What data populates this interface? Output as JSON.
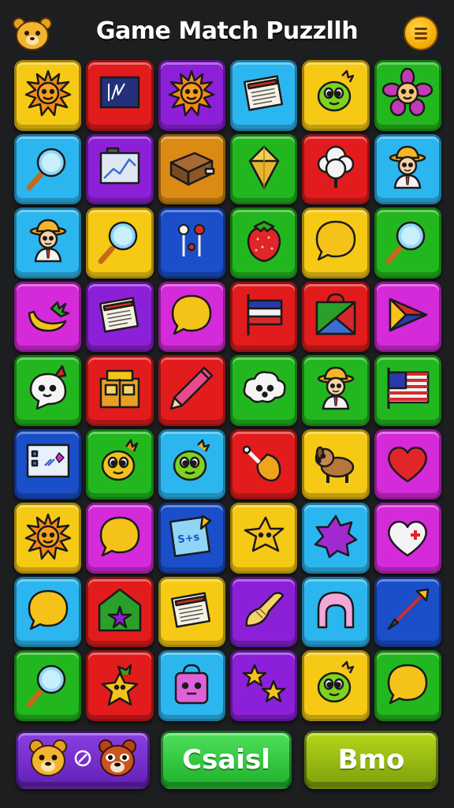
{
  "header": {
    "title": "Game Match Puzzllh",
    "logo_icon": "bear-face-icon",
    "menu_icon": "hamburger-menu-icon"
  },
  "colors": {
    "yellow": "#f6c915",
    "red": "#e21c1c",
    "purple": "#8c20d8",
    "cyan": "#2cb6ef",
    "green": "#22b71e",
    "orange": "#db8a14",
    "blue": "#1a4fc9",
    "magenta": "#d42ad9",
    "background": "#1d1e20"
  },
  "board": {
    "rows": [
      [
        {
          "color": "yellow",
          "icon": "sun-icon"
        },
        {
          "color": "red",
          "icon": "chalkboard-icon"
        },
        {
          "color": "purple",
          "icon": "sun-icon"
        },
        {
          "color": "cyan",
          "icon": "newspaper-icon"
        },
        {
          "color": "yellow",
          "icon": "green-bird-icon"
        },
        {
          "color": "green",
          "icon": "purple-flower-icon"
        }
      ],
      [
        {
          "color": "cyan",
          "icon": "magnifier-icon"
        },
        {
          "color": "purple",
          "icon": "chart-folder-icon"
        },
        {
          "color": "orange",
          "icon": "treasure-box-icon"
        },
        {
          "color": "green",
          "icon": "diamond-icon"
        },
        {
          "color": "red",
          "icon": "cloud-tree-icon"
        },
        {
          "color": "cyan",
          "icon": "explorer-icon"
        }
      ],
      [
        {
          "color": "cyan",
          "icon": "explorer-icon"
        },
        {
          "color": "yellow",
          "icon": "magnifier-icon"
        },
        {
          "color": "blue",
          "icon": "pins-icon"
        },
        {
          "color": "green",
          "icon": "strawberry-icon"
        },
        {
          "color": "yellow",
          "icon": "speech-bubble-icon"
        },
        {
          "color": "green",
          "icon": "magnifier-icon"
        }
      ],
      [
        {
          "color": "magenta",
          "icon": "banana-icon"
        },
        {
          "color": "purple",
          "icon": "newspaper-icon"
        },
        {
          "color": "magenta",
          "icon": "speech-bubble-icon"
        },
        {
          "color": "red",
          "icon": "flag-icon"
        },
        {
          "color": "red",
          "icon": "gift-bag-icon"
        },
        {
          "color": "magenta",
          "icon": "play-flag-icon"
        }
      ],
      [
        {
          "color": "green",
          "icon": "ghost-icon"
        },
        {
          "color": "red",
          "icon": "package-icon"
        },
        {
          "color": "red",
          "icon": "pen-icon"
        },
        {
          "color": "green",
          "icon": "cloud-face-icon"
        },
        {
          "color": "green",
          "icon": "explorer-icon"
        },
        {
          "color": "green",
          "icon": "usa-flag-icon"
        }
      ],
      [
        {
          "color": "blue",
          "icon": "whiteboard-icon"
        },
        {
          "color": "green",
          "icon": "yellow-bird-icon"
        },
        {
          "color": "cyan",
          "icon": "green-bird-icon"
        },
        {
          "color": "red",
          "icon": "chicken-leg-icon"
        },
        {
          "color": "yellow",
          "icon": "dog-icon"
        },
        {
          "color": "magenta",
          "icon": "heart-icon"
        }
      ],
      [
        {
          "color": "yellow",
          "icon": "sun-icon"
        },
        {
          "color": "magenta",
          "icon": "speech-bubble-icon"
        },
        {
          "color": "blue",
          "icon": "notepad-icon"
        },
        {
          "color": "yellow",
          "icon": "star-blob-icon"
        },
        {
          "color": "cyan",
          "icon": "purple-star-icon"
        },
        {
          "color": "magenta",
          "icon": "heart-plus-icon"
        }
      ],
      [
        {
          "color": "cyan",
          "icon": "speech-bubble-icon"
        },
        {
          "color": "red",
          "icon": "house-star-icon"
        },
        {
          "color": "yellow",
          "icon": "newspaper-icon"
        },
        {
          "color": "purple",
          "icon": "brush-icon"
        },
        {
          "color": "cyan",
          "icon": "arch-icon"
        },
        {
          "color": "blue",
          "icon": "arrow-icon"
        }
      ],
      [
        {
          "color": "green",
          "icon": "magnifier-icon"
        },
        {
          "color": "red",
          "icon": "yellow-star-character-icon"
        },
        {
          "color": "cyan",
          "icon": "robot-bag-icon"
        },
        {
          "color": "purple",
          "icon": "stars-icon"
        },
        {
          "color": "yellow",
          "icon": "green-bird-icon"
        },
        {
          "color": "green",
          "icon": "speech-bubble-icon"
        }
      ]
    ]
  },
  "footer": {
    "pets_icons": [
      "bear-face-icon",
      "link-icon",
      "red-panda-icon"
    ],
    "middle_label": "Csaisl",
    "right_label": "Bmo"
  }
}
